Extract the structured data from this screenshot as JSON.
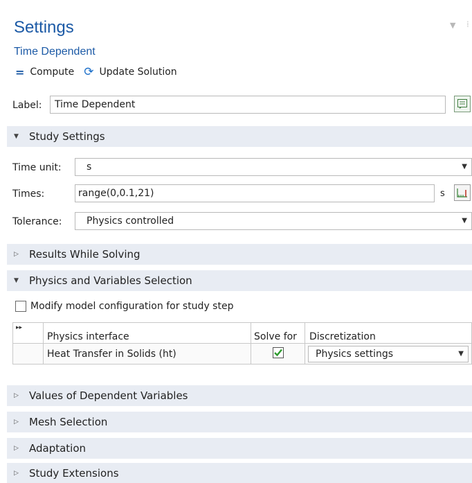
{
  "header": {
    "title": "Settings",
    "subtitle": "Time Dependent",
    "compute_label": "Compute",
    "update_label": "Update Solution"
  },
  "label_row": {
    "label": "Label:",
    "value": "Time Dependent"
  },
  "study_settings": {
    "heading": "Study Settings",
    "time_unit_label": "Time unit:",
    "time_unit_value": "s",
    "times_label": "Times:",
    "times_value": "range(0,0.1,21)",
    "times_unit": "s",
    "tolerance_label": "Tolerance:",
    "tolerance_value": "Physics controlled"
  },
  "sections": {
    "results_while_solving": "Results While Solving",
    "physics_selection": "Physics and Variables Selection",
    "values_dependent": "Values of Dependent Variables",
    "mesh_selection": "Mesh Selection",
    "adaptation": "Adaptation",
    "study_extensions": "Study Extensions"
  },
  "physics": {
    "modify_label": "Modify model configuration for study step",
    "col_interface": "Physics interface",
    "col_solve": "Solve for",
    "col_discretization": "Discretization",
    "expand_marker": "▸▸",
    "rows": [
      {
        "interface": "Heat Transfer in Solids (ht)",
        "solve": true,
        "discretization": "Physics settings"
      }
    ]
  },
  "colors": {
    "accent": "#1c5aa6",
    "section_bg": "#e8ecf3",
    "check_green": "#2e9a2e"
  }
}
